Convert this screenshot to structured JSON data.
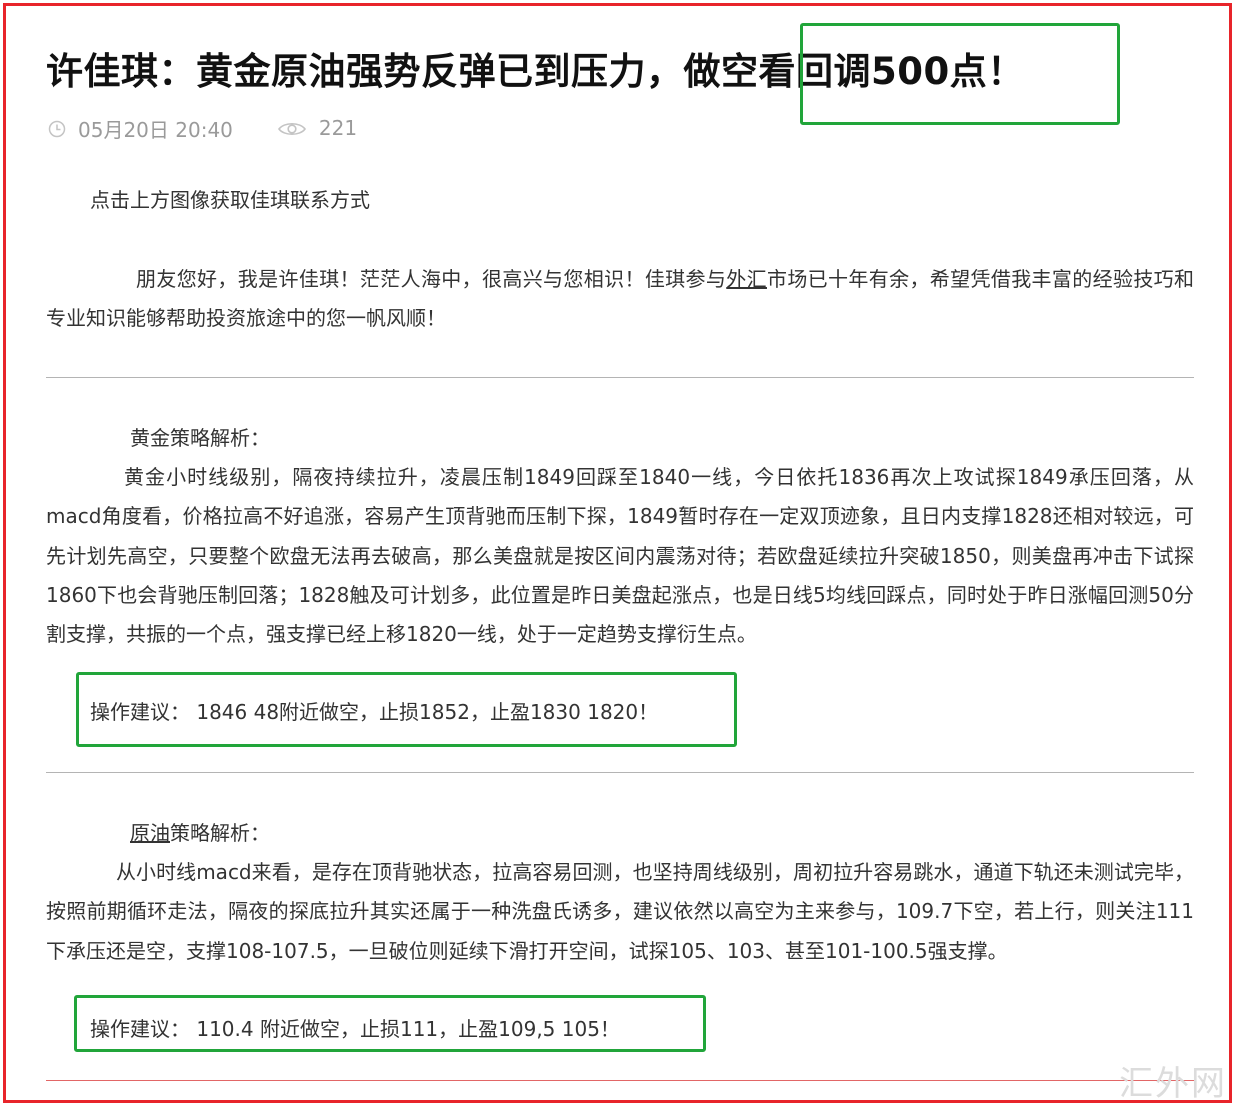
{
  "article": {
    "title": "许佳琪：黄金原油强势反弹已到压力，做空看回调500点！",
    "meta": {
      "date": "05月20日 20:40",
      "views": "221"
    },
    "intro_contact": "点击上方图像获取佳琪联系方式",
    "greeting": {
      "before_link": "朋友您好，我是许佳琪！茫茫人海中，很高兴与您相识！佳琪参与",
      "link": "外汇",
      "after_link": "市场已十年有余，希望凭借我丰富的经验技巧和专业知识能够帮助投资旅途中的您一帆风顺！"
    },
    "gold": {
      "heading": "黄金策略解析：",
      "body": "黄金小时线级别，隔夜持续拉升，凌晨压制1849回踩至1840一线，今日依托1836再次上攻试探1849承压回落，从macd角度看，价格拉高不好追涨，容易产生顶背驰而压制下探，1849暂时存在一定双顶迹象，且日内支撑1828还相对较远，可先计划先高空，只要整个欧盘无法再去破高，那么美盘就是按区间内震荡对待；若欧盘延续拉升突破1850，则美盘再冲击下试探1860下也会背驰压制回落；1828触及可计划多，此位置是昨日美盘起涨点，也是日线5均线回踩点，同时处于昨日涨幅回测50分割支撑，共振的一个点，强支撑已经上移1820一线，处于一定趋势支撑衍生点。",
      "advice": "操作建议： 1846 48附近做空，止损1852，止盈1830 1820！"
    },
    "oil": {
      "heading_link": "原油",
      "heading_rest": "策略解析：",
      "body": "从小时线macd来看，是存在顶背驰状态，拉高容易回测，也坚持周线级别，周初拉升容易跳水，通道下轨还未测试完毕，按照前期循环走法，隔夜的探底拉升其实还属于一种洗盘氏诱多，建议依然以高空为主来参与，109.7下空，若上行，则关注111下承压还是空，支撑108-107.5，一旦破位则延续下滑打开空间，试探105、103、甚至101-100.5强支撑。",
      "advice": "操作建议： 110.4 附近做空，止损111，止盈109,5 105！"
    }
  },
  "watermark": "汇外网",
  "colors": {
    "frame_red": "#e8242a",
    "highlight_green": "#21a53a",
    "meta_gray": "#9a9a9a",
    "body_text": "#333333"
  },
  "icons": {
    "clock": "clock-icon",
    "eye": "eye-icon"
  }
}
